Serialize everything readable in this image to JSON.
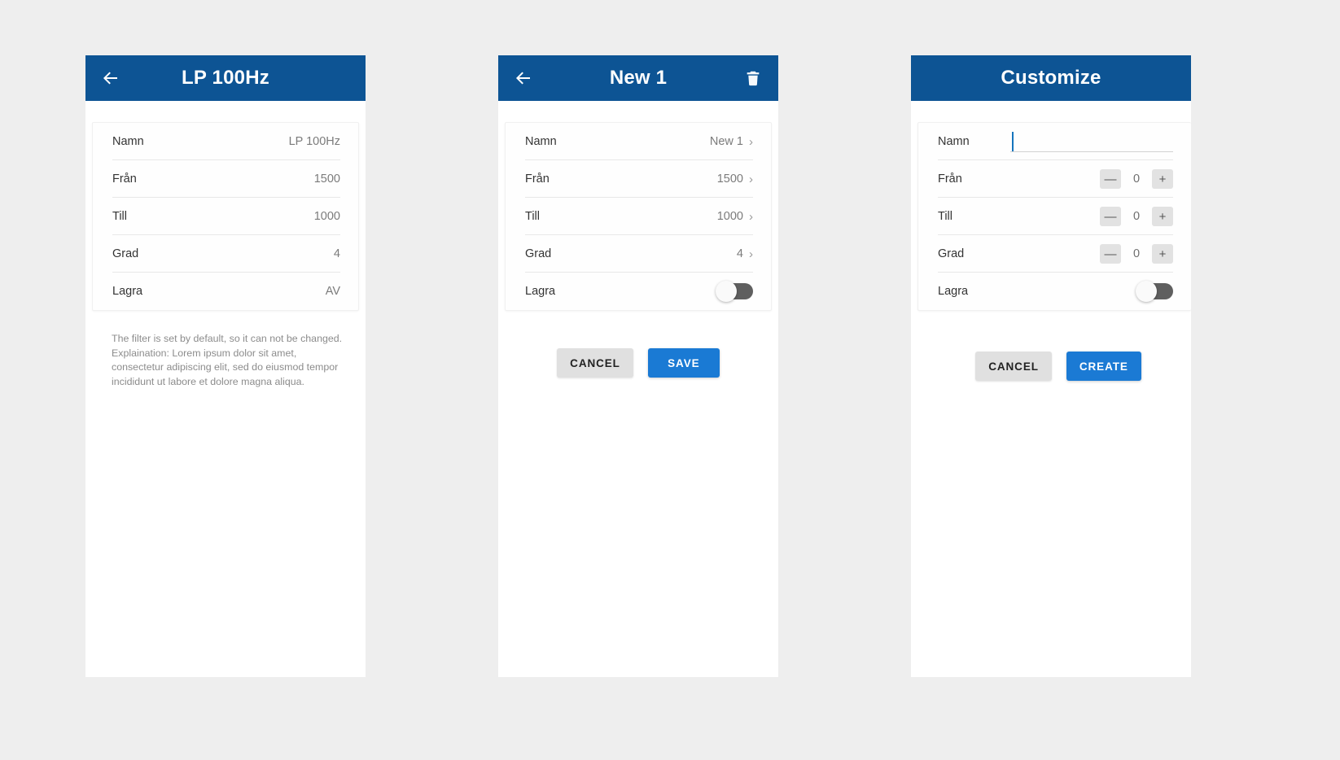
{
  "theme": {
    "page_bg": "#eeeeee",
    "appbar_blue": "#0d5494",
    "primary_blue": "#1a7ad4",
    "flat_gray": "#e0e0e0",
    "caret_blue": "#1675bd",
    "toggle_track": "#5f5f5f",
    "label_color": "#333333",
    "value_color": "#7b7b7b",
    "helper_color": "#8c8c8c"
  },
  "screens": [
    {
      "id": "filter-detail-readonly",
      "appbar": {
        "title": "LP 100Hz",
        "back_icon": "arrow-left-icon",
        "has_back": true,
        "has_delete": false
      },
      "rows": [
        {
          "label": "Namn",
          "value": "LP 100Hz"
        },
        {
          "label": "Från",
          "value": "1500"
        },
        {
          "label": "Till",
          "value": "1000"
        },
        {
          "label": "Grad",
          "value": "4"
        },
        {
          "label": "Lagra",
          "value": "AV"
        }
      ],
      "explanation": [
        "The filter is set by default, so it can not be changed.",
        "Explaination: Lorem ipsum dolor sit amet,",
        "consectetur adipiscing elit, sed do eiusmod tempor",
        "incididunt ut labore et dolore magna aliqua."
      ]
    },
    {
      "id": "filter-edit",
      "appbar": {
        "title": "New 1",
        "back_icon": "arrow-left-icon",
        "delete_icon": "trash-icon",
        "has_back": true,
        "has_delete": true
      },
      "rows": [
        {
          "label": "Namn",
          "value": "New 1",
          "chevron": "›"
        },
        {
          "label": "Från",
          "value": "1500",
          "chevron": "›"
        },
        {
          "label": "Till",
          "value": "1000",
          "chevron": "›"
        },
        {
          "label": "Grad",
          "value": "4",
          "chevron": "›"
        }
      ],
      "toggle_row": {
        "label": "Lagra",
        "state": "off"
      },
      "buttons": {
        "secondary": "CANCEL",
        "primary": "SAVE"
      }
    },
    {
      "id": "filter-create",
      "appbar": {
        "title": "Customize",
        "has_back": false,
        "has_delete": false
      },
      "name_row": {
        "label": "Namn",
        "value": "",
        "placeholder": ""
      },
      "stepper_rows": [
        {
          "label": "Från",
          "value": "0",
          "minus": "—",
          "plus": "+"
        },
        {
          "label": "Till",
          "value": "0",
          "minus": "—",
          "plus": "+"
        },
        {
          "label": "Grad",
          "value": "0",
          "minus": "—",
          "plus": "+"
        }
      ],
      "toggle_row": {
        "label": "Lagra",
        "state": "off"
      },
      "buttons": {
        "secondary": "CANCEL",
        "primary": "CREATE"
      }
    }
  ]
}
